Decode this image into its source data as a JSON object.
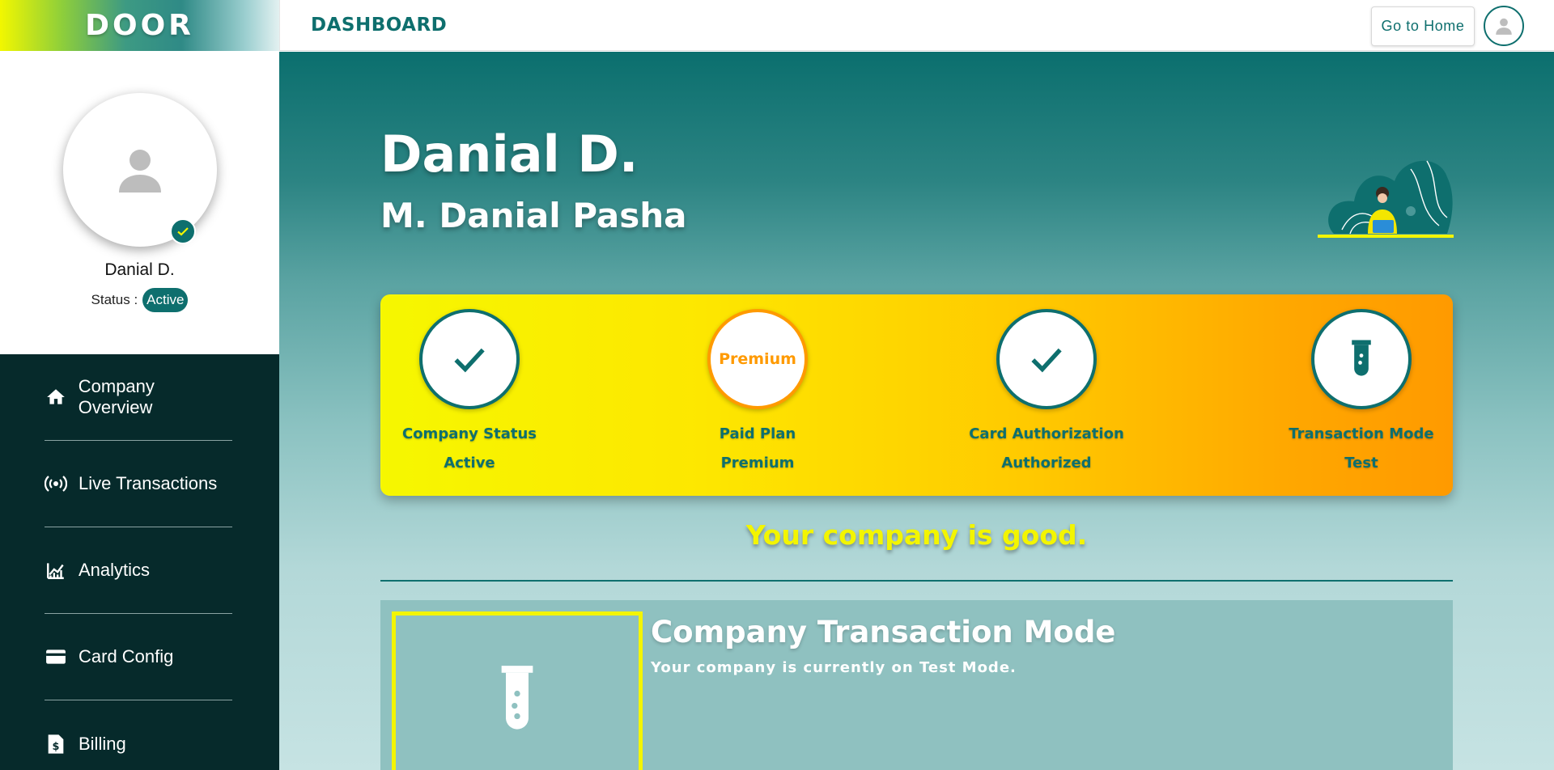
{
  "brand": {
    "name": "DOOR"
  },
  "profile": {
    "name": "Danial D.",
    "status_label": "Status :",
    "status_value": "Active",
    "avatar_icon": "user-placeholder-icon",
    "verified_icon": "check-badge-icon"
  },
  "sidebar": {
    "items": [
      {
        "label": "Company Overview",
        "icon": "home-icon"
      },
      {
        "label": "Live Transactions",
        "icon": "broadcast-icon"
      },
      {
        "label": "Analytics",
        "icon": "analytics-icon"
      },
      {
        "label": "Card Config",
        "icon": "credit-card-icon"
      },
      {
        "label": "Billing",
        "icon": "billing-icon"
      }
    ]
  },
  "topbar": {
    "title": "DASHBOARD",
    "home_button": "Go to Home",
    "avatar_icon": "user-icon"
  },
  "hero": {
    "name": "Danial D.",
    "full_name": "M. Danial Pasha"
  },
  "stats": [
    {
      "label": "Company Status",
      "value": "Active",
      "icon": "check-icon"
    },
    {
      "label": "Paid Plan",
      "value": "Premium",
      "badge": "Premium"
    },
    {
      "label": "Card Authorization",
      "value": "Authorized",
      "icon": "check-icon"
    },
    {
      "label": "Transaction Mode",
      "value": "Test",
      "icon": "test-tube-icon"
    }
  ],
  "message": "Your company is good.",
  "transaction_mode": {
    "title": "Company Transaction Mode",
    "description": "Your company is currently on Test Mode.",
    "icon": "test-tube-icon"
  },
  "colors": {
    "primary": "#0e6f6e",
    "sidebar_dark": "#062a2b",
    "accent_yellow": "#f3f500",
    "accent_orange": "#ff9a00"
  }
}
